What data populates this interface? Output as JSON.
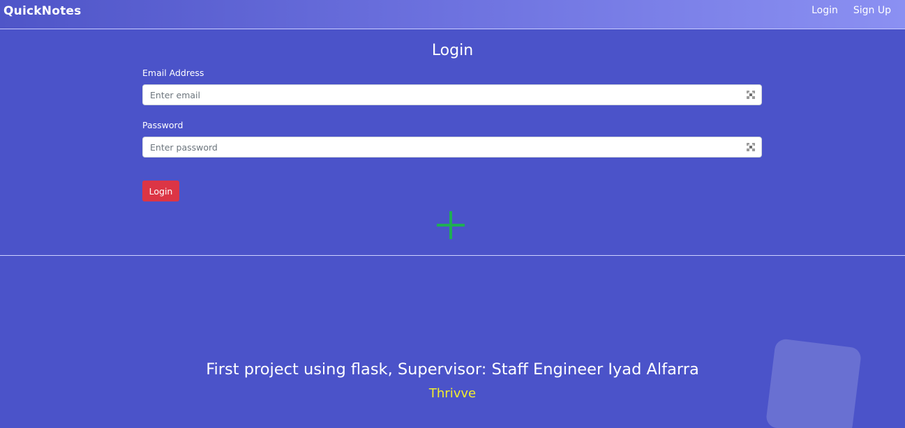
{
  "navbar": {
    "brand": "QuickNotes",
    "links": [
      "Login",
      "Sign Up"
    ]
  },
  "login": {
    "title": "Login",
    "email": {
      "label": "Email Address",
      "placeholder": "Enter email",
      "value": ""
    },
    "password": {
      "label": "Password",
      "placeholder": "Enter password",
      "value": ""
    },
    "submit_label": "Login"
  },
  "footer": {
    "text": "First project using flask, Supervisor: Staff Engineer Iyad Alfarra",
    "brand": "Thrivve"
  },
  "icons": {
    "field_icon": "password-manager-icon",
    "add": "plus-icon"
  },
  "colors": {
    "background": "#4b53c9",
    "navbar_start": "#4f55c8",
    "navbar_end": "#8b90f2",
    "login_button": "#dc3545",
    "plus": "#1fae55",
    "footer_brand": "#f2ee2c"
  }
}
